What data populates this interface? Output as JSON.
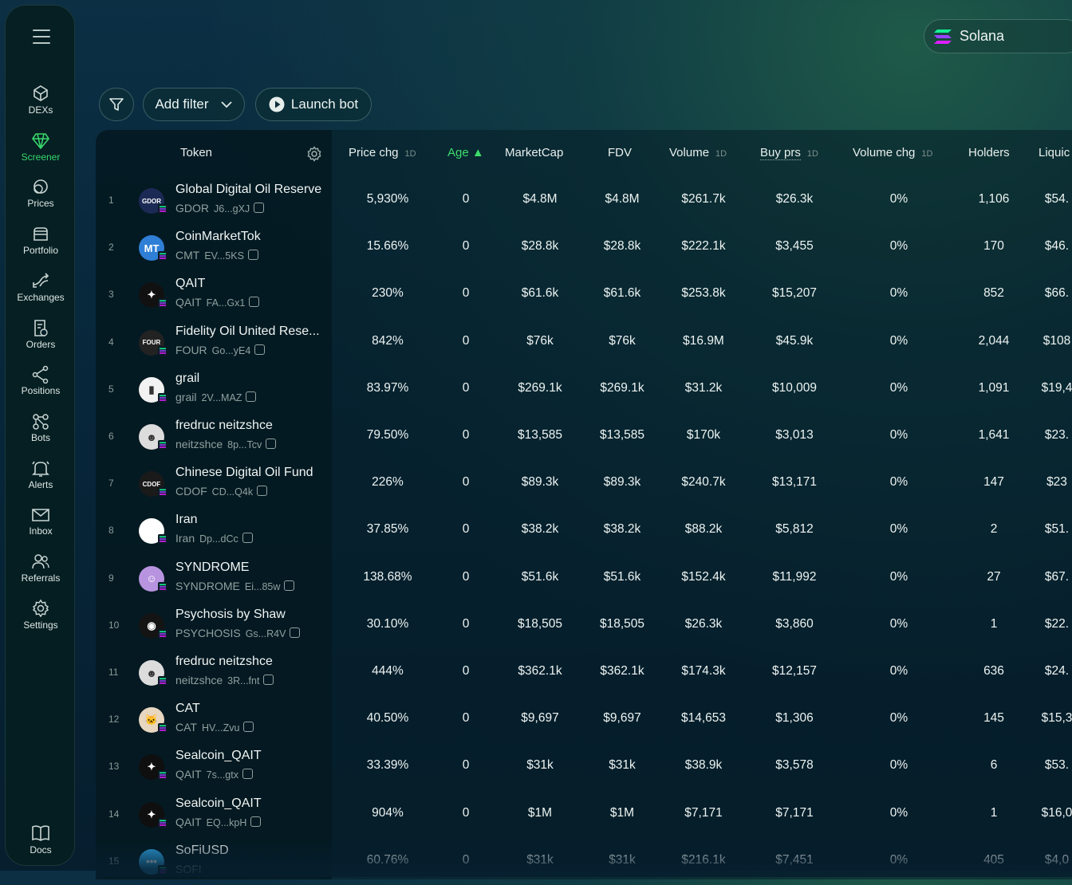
{
  "sidebar": {
    "items": [
      {
        "label": "DEXs",
        "icon": "dex-icon"
      },
      {
        "label": "Screener",
        "icon": "diamond-icon",
        "active": true
      },
      {
        "label": "Prices",
        "icon": "coins-icon"
      },
      {
        "label": "Portfolio",
        "icon": "wallet-icon"
      },
      {
        "label": "Exchanges",
        "icon": "exchange-arrows-icon"
      },
      {
        "label": "Orders",
        "icon": "orders-clock-icon"
      },
      {
        "label": "Positions",
        "icon": "share-nodes-icon"
      },
      {
        "label": "Bots",
        "icon": "bot-nodes-icon"
      },
      {
        "label": "Alerts",
        "icon": "bell-icon"
      },
      {
        "label": "Inbox",
        "icon": "mail-icon"
      },
      {
        "label": "Referrals",
        "icon": "users-icon"
      },
      {
        "label": "Settings",
        "icon": "gear-icon"
      }
    ],
    "docs_label": "Docs"
  },
  "network": {
    "label": "Solana",
    "icon": "solana-icon"
  },
  "toolbar": {
    "add_filter": "Add filter",
    "launch_bot": "Launch bot"
  },
  "table": {
    "headers": {
      "token": "Token",
      "price_chg": "Price chg",
      "price_chg_tf": "1D",
      "age": "Age ▲",
      "market_cap": "MarketCap",
      "fdv": "FDV",
      "volume": "Volume",
      "volume_tf": "1D",
      "buy_prs": "Buy prs",
      "buy_prs_tf": "1D",
      "volume_chg": "Volume chg",
      "volume_chg_tf": "1D",
      "holders": "Holders",
      "liquidity": "Liquic"
    },
    "rows": [
      {
        "rank": "1",
        "name": "Global Digital Oil Reserve",
        "symbol": "GDOR",
        "addr": "J6...gXJ",
        "price_chg": "5,930%",
        "age": "0",
        "mcap": "$4.8M",
        "fdv": "$4.8M",
        "volume": "$261.7k",
        "buy": "$26.3k",
        "vol_chg": "0%",
        "holders": "1,106",
        "liq": "$54.",
        "avatar_color": "#1b2a55",
        "avatar_text": "GDOR"
      },
      {
        "rank": "2",
        "name": "CoinMarketTok",
        "symbol": "CMT",
        "addr": "EV...5KS",
        "price_chg": "15.66%",
        "age": "0",
        "mcap": "$28.8k",
        "fdv": "$28.8k",
        "volume": "$222.1k",
        "buy": "$3,455",
        "vol_chg": "0%",
        "holders": "170",
        "liq": "$46.",
        "avatar_color": "#2f7fd6",
        "avatar_text": "MT"
      },
      {
        "rank": "3",
        "name": "QAIT",
        "symbol": "QAIT",
        "addr": "FA...Gx1",
        "price_chg": "230%",
        "age": "0",
        "mcap": "$61.6k",
        "fdv": "$61.6k",
        "volume": "$253.8k",
        "buy": "$15,207",
        "vol_chg": "0%",
        "holders": "852",
        "liq": "$66.",
        "avatar_color": "#111111",
        "avatar_text": "✦"
      },
      {
        "rank": "4",
        "name": "Fidelity Oil United Rese...",
        "symbol": "FOUR",
        "addr": "Go...yE4",
        "price_chg": "842%",
        "age": "0",
        "mcap": "$76k",
        "fdv": "$76k",
        "volume": "$16.9M",
        "buy": "$45.9k",
        "vol_chg": "0%",
        "holders": "2,044",
        "liq": "$108",
        "avatar_color": "#222222",
        "avatar_text": "FOUR"
      },
      {
        "rank": "5",
        "name": "grail",
        "symbol": "grail",
        "addr": "2V...MAZ",
        "price_chg": "83.97%",
        "age": "0",
        "mcap": "$269.1k",
        "fdv": "$269.1k",
        "volume": "$31.2k",
        "buy": "$10,009",
        "vol_chg": "0%",
        "holders": "1,091",
        "liq": "$19,4",
        "avatar_color": "#f2f2f2",
        "avatar_text": "▮"
      },
      {
        "rank": "6",
        "name": "fredruc neitzshce",
        "symbol": "neitzshce",
        "addr": "8p...Tcv",
        "price_chg": "79.50%",
        "age": "0",
        "mcap": "$13,585",
        "fdv": "$13,585",
        "volume": "$170k",
        "buy": "$3,013",
        "vol_chg": "0%",
        "holders": "1,641",
        "liq": "$23.",
        "avatar_color": "#dcdcdc",
        "avatar_text": "☻"
      },
      {
        "rank": "7",
        "name": "Chinese Digital Oil Fund",
        "symbol": "CDOF",
        "addr": "CD...Q4k",
        "price_chg": "226%",
        "age": "0",
        "mcap": "$89.3k",
        "fdv": "$89.3k",
        "volume": "$240.7k",
        "buy": "$13,171",
        "vol_chg": "0%",
        "holders": "147",
        "liq": "$23",
        "avatar_color": "#1a1a1a",
        "avatar_text": "CDOF"
      },
      {
        "rank": "8",
        "name": "Iran",
        "symbol": "Iran",
        "addr": "Dp...dCc",
        "price_chg": "37.85%",
        "age": "0",
        "mcap": "$38.2k",
        "fdv": "$38.2k",
        "volume": "$88.2k",
        "buy": "$5,812",
        "vol_chg": "0%",
        "holders": "2",
        "liq": "$51.",
        "avatar_color": "#ffffff",
        "avatar_text": ""
      },
      {
        "rank": "9",
        "name": "SYNDROME",
        "symbol": "SYNDROME",
        "addr": "Ei...85w",
        "price_chg": "138.68%",
        "age": "0",
        "mcap": "$51.6k",
        "fdv": "$51.6k",
        "volume": "$152.4k",
        "buy": "$11,992",
        "vol_chg": "0%",
        "holders": "27",
        "liq": "$67.",
        "avatar_color": "#b894e0",
        "avatar_text": "☺"
      },
      {
        "rank": "10",
        "name": "Psychosis by Shaw",
        "symbol": "PSYCHOSIS",
        "addr": "Gs...R4V",
        "price_chg": "30.10%",
        "age": "0",
        "mcap": "$18,505",
        "fdv": "$18,505",
        "volume": "$26.3k",
        "buy": "$3,860",
        "vol_chg": "0%",
        "holders": "1",
        "liq": "$22.",
        "avatar_color": "#141414",
        "avatar_text": "◉"
      },
      {
        "rank": "11",
        "name": "fredruc neitzshce",
        "symbol": "neitzshce",
        "addr": "3R...fnt",
        "price_chg": "444%",
        "age": "0",
        "mcap": "$362.1k",
        "fdv": "$362.1k",
        "volume": "$174.3k",
        "buy": "$12,157",
        "vol_chg": "0%",
        "holders": "636",
        "liq": "$24.",
        "avatar_color": "#dcdcdc",
        "avatar_text": "☻"
      },
      {
        "rank": "12",
        "name": "CAT",
        "symbol": "CAT",
        "addr": "HV...Zvu",
        "price_chg": "40.50%",
        "age": "0",
        "mcap": "$9,697",
        "fdv": "$9,697",
        "volume": "$14,653",
        "buy": "$1,306",
        "vol_chg": "0%",
        "holders": "145",
        "liq": "$15,3",
        "avatar_color": "#e7d6c0",
        "avatar_text": "🐱"
      },
      {
        "rank": "13",
        "name": "Sealcoin_QAIT",
        "symbol": "QAIT",
        "addr": "7s...gtx",
        "price_chg": "33.39%",
        "age": "0",
        "mcap": "$31k",
        "fdv": "$31k",
        "volume": "$38.9k",
        "buy": "$3,578",
        "vol_chg": "0%",
        "holders": "6",
        "liq": "$53.",
        "avatar_color": "#0f0f0f",
        "avatar_text": "✦"
      },
      {
        "rank": "14",
        "name": "Sealcoin_QAIT",
        "symbol": "QAIT",
        "addr": "EQ...kpH",
        "price_chg": "904%",
        "age": "0",
        "mcap": "$1M",
        "fdv": "$1M",
        "volume": "$7,171",
        "buy": "$7,171",
        "vol_chg": "0%",
        "holders": "1",
        "liq": "$16,0",
        "avatar_color": "#0f0f0f",
        "avatar_text": "✦"
      },
      {
        "rank": "15",
        "name": "SoFiUSD",
        "symbol": "SOFI",
        "addr": "",
        "price_chg": "60.76%",
        "age": "0",
        "mcap": "$31k",
        "fdv": "$31k",
        "volume": "$216.1k",
        "buy": "$7,451",
        "vol_chg": "0%",
        "holders": "405",
        "liq": "$4,0",
        "avatar_color": "#2fa6e8",
        "avatar_text": "•••"
      }
    ]
  }
}
